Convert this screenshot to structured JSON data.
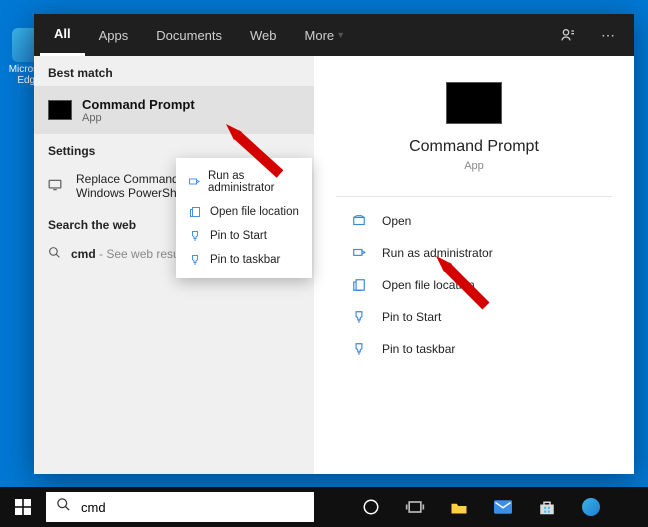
{
  "desktop_icon_label": "Microsoft Edge",
  "tabs": {
    "all": "All",
    "apps": "Apps",
    "documents": "Documents",
    "web": "Web",
    "more": "More"
  },
  "sections": {
    "best_match": "Best match",
    "settings": "Settings",
    "search_web": "Search the web"
  },
  "best_match": {
    "title": "Command Prompt",
    "sub": "App"
  },
  "settings_item": "Replace Command Prompt with Windows PowerShell",
  "web_item": {
    "query": "cmd",
    "suffix": " - See web results"
  },
  "context_menu": {
    "run_admin": "Run as administrator",
    "open_loc": "Open file location",
    "pin_start": "Pin to Start",
    "pin_taskbar": "Pin to taskbar"
  },
  "detail": {
    "title": "Command Prompt",
    "sub": "App"
  },
  "actions": {
    "open": "Open",
    "run_admin": "Run as administrator",
    "open_loc": "Open file location",
    "pin_start": "Pin to Start",
    "pin_taskbar": "Pin to taskbar"
  },
  "search_input": "cmd"
}
